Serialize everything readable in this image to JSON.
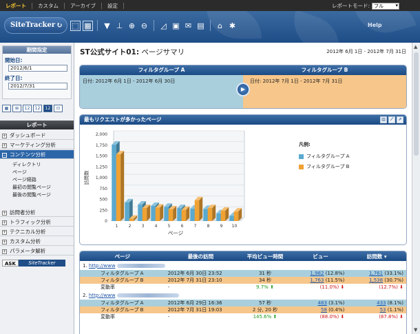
{
  "topnav": {
    "items": [
      "レポート",
      "カスタム",
      "アーカイブ",
      "設定"
    ],
    "mode_label": "レポートモード:",
    "mode_value": "フル"
  },
  "header": {
    "logo": "SiteTracker",
    "help": "Help"
  },
  "sidebar": {
    "period": {
      "title": "期間指定",
      "start_label": "開始日:",
      "start_value": "2012/6/1",
      "end_label": "終了日:",
      "end_value": "2012/7/31"
    },
    "period_icons": [
      "▦",
      "⊞",
      "12",
      "12",
      "12",
      "⊡"
    ],
    "report_title": "レポート",
    "reports": [
      {
        "label": "ダッシュボード",
        "sign": "+"
      },
      {
        "label": "マーケティング分析",
        "sign": "+"
      },
      {
        "label": "コンテンツ分析",
        "sign": "−"
      },
      {
        "label": "訪問者分析",
        "sign": "+"
      },
      {
        "label": "トラフィック分析",
        "sign": "+"
      },
      {
        "label": "テクニカル分析",
        "sign": "+"
      },
      {
        "label": "カスタム分析",
        "sign": "+"
      },
      {
        "label": "パラメータ解析",
        "sign": "+"
      }
    ],
    "content_sub": [
      "ディレクトリ",
      "ページ",
      "ページ経路",
      "最初の閲覧ページ",
      "最後の閲覧ページ"
    ],
    "ask": {
      "a1": "ASK",
      "a2": "SiteTracker"
    }
  },
  "main": {
    "title_bold": "ST公式サイト01:",
    "title_rest": " ページサマリ",
    "date_range": "2012年 6月 1日 - 2012年 7月 31日",
    "filter": {
      "a_title": "フィルタグループ A",
      "b_title": "フィルタグループ B",
      "a_date": "日付: 2012年 6月 1日 - 2012年 6月 30日",
      "b_date": "日付: 2012年 7月 1日 - 2012年 7月 31日"
    },
    "chart_title": "最もリクエストが多かったページ",
    "legend_title": "凡例:",
    "legend": [
      "フィルタグループ A",
      "フィルタグループ B"
    ],
    "table": {
      "headers": [
        "ページ",
        "最後の訪問",
        "平均ビュー時間",
        "ビュー",
        "訪問数"
      ],
      "rows": [
        {
          "num": "1.",
          "url": "http://www",
          "a": {
            "label": "フィルタグループ A",
            "last": "2012年 6月 30日 23:52",
            "avg": "31 秒",
            "views": "1,982",
            "views_pct": "(12.8%)",
            "visits": "1,761",
            "visits_pct": "(33.1%)"
          },
          "b": {
            "label": "フィルタグループ B",
            "last": "2012年 7月 31日 23:10",
            "avg": "34 秒",
            "views": "1,763",
            "views_pct": "(11.5%)",
            "visits": "1,538",
            "visits_pct": "(30.7%)"
          },
          "rate": {
            "label": "変動率",
            "last": "-",
            "avg": "9.7%",
            "views": "(11.0%)",
            "visits": "(12.7%)"
          }
        },
        {
          "num": "2.",
          "url": "http://www",
          "a": {
            "label": "フィルタグループ A",
            "last": "2012年 6月 29日 16:36",
            "avg": "57 秒",
            "views": "483",
            "views_pct": "(3.1%)",
            "visits": "433",
            "visits_pct": "(8.1%)"
          },
          "b": {
            "label": "フィルタグループ B",
            "last": "2012年 7月 31日 19:03",
            "avg": "2 分, 20 秒",
            "views": "58",
            "views_pct": "(0.4%)",
            "visits": "53",
            "visits_pct": "(1.1%)"
          },
          "rate": {
            "label": "変動率",
            "last": "-",
            "avg": "145.6%",
            "views": "(88.0%)",
            "visits": "(87.8%)"
          }
        }
      ]
    }
  },
  "chart_data": {
    "type": "bar",
    "title": "最もリクエストが多かったページ",
    "xlabel": "ページ",
    "ylabel": "訪問数",
    "categories": [
      "1",
      "2",
      "3",
      "4",
      "5",
      "6",
      "7",
      "8",
      "9",
      "10"
    ],
    "yticks": [
      "0",
      "250",
      "500",
      "750",
      "1,000",
      "1,250",
      "1,500",
      "1,750",
      "2,000"
    ],
    "ylim": [
      0,
      2000
    ],
    "series": [
      {
        "name": "フィルタグループ A",
        "color": "#5aa9cf",
        "values": [
          1761,
          433,
          380,
          350,
          330,
          300,
          290,
          280,
          180,
          120
        ]
      },
      {
        "name": "フィルタグループ B",
        "color": "#f0a232",
        "values": [
          1538,
          53,
          300,
          310,
          270,
          260,
          480,
          300,
          240,
          220
        ]
      }
    ],
    "grid": true,
    "legend_position": "right"
  }
}
